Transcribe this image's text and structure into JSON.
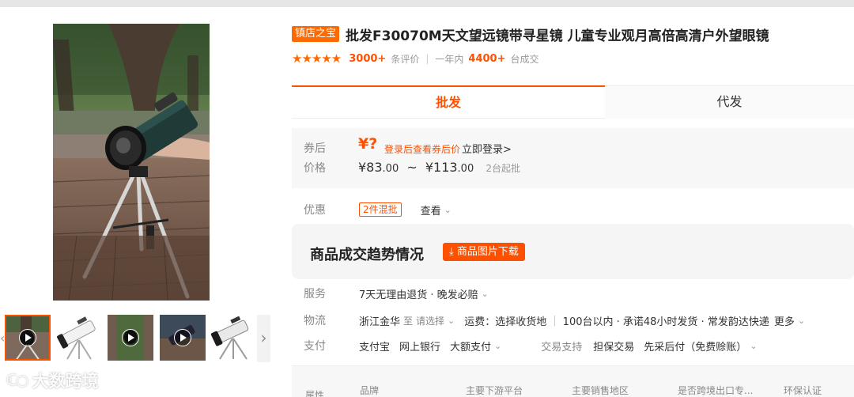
{
  "gallery": {
    "thumbnails": [
      {
        "name": "thumb-video-1",
        "video": true,
        "active": true
      },
      {
        "name": "thumb-telescope-white",
        "video": false,
        "active": false
      },
      {
        "name": "thumb-video-2",
        "video": true,
        "active": false
      },
      {
        "name": "thumb-video-3",
        "video": true,
        "active": false
      },
      {
        "name": "thumb-telescope-tripod",
        "video": false,
        "active": false
      }
    ],
    "arrow_left": "‹",
    "arrow_right": "›",
    "watermark": "大数跨境",
    "watermark_logo": "ℂ○"
  },
  "product": {
    "badge": "镇店之宝",
    "title": "批发F30070M天文望远镜带寻星镜 儿童专业观月高倍高清户外望眼镜",
    "stars": "★★★★★",
    "review_count": "3000+",
    "review_label": "条评价",
    "year_label": "一年内",
    "sold_count": "4400+",
    "sold_label": "台成交"
  },
  "tabs": {
    "wholesale": "批发",
    "dropship": "代发"
  },
  "price": {
    "coupon_label": "券后",
    "coupon_symbol": "¥?",
    "coupon_text": "登录后查看券后价",
    "login_link": "立即登录>",
    "price_label": "价格",
    "low": "¥83",
    "low_decimal": ".00",
    "tilde": "~",
    "high": "¥113",
    "high_decimal": ".00",
    "min_order": "2台起批"
  },
  "discount": {
    "label": "优惠",
    "tag": "2件混批",
    "view": "查看"
  },
  "trend": {
    "title": "商品成交趋势情况",
    "download": "商品图片下载"
  },
  "service": {
    "label": "服务",
    "text": "7天无理由退货 · 晚发必赔"
  },
  "logistics": {
    "label": "物流",
    "origin": "浙江金华",
    "to": "至",
    "select": "请选择",
    "fee": "运费：选择收货地",
    "promise": "100台以内 · 承诺48小时发货 · 常发韵达快递",
    "more": "更多"
  },
  "payment": {
    "label": "支付",
    "alipay": "支付宝",
    "bank": "网上银行",
    "large": "大额支付",
    "trade_label": "交易支持",
    "guarantee": "担保交易",
    "paylater": "先采后付（免费赊账）"
  },
  "attributes": {
    "label": "属性",
    "headers": [
      "品牌",
      "主要下游平台",
      "主要销售地区",
      "是否跨境出口专...",
      "环保认证"
    ]
  },
  "icons": {
    "chevron": "⌄",
    "download": "⤓"
  },
  "colors": {
    "accent": "#ff5000",
    "badge": "#ff6a00"
  }
}
